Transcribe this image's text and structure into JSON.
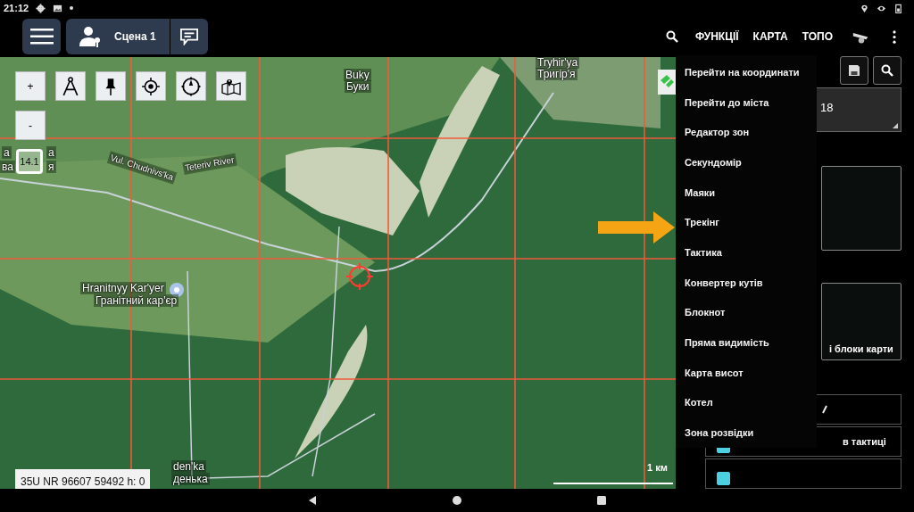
{
  "status_bar": {
    "time": "21:12"
  },
  "app_bar": {
    "scene_label": "Сцена 1",
    "actions": [
      "ФУНКЦІЇ",
      "КАРТА",
      "ТОПО"
    ]
  },
  "map": {
    "zoom": "14.1",
    "scale": "1 км",
    "coordinates": "35U NR 96607 59492 h: 0",
    "zoom_in": "+",
    "zoom_out": "-",
    "labels": [
      {
        "text": "Buky"
      },
      {
        "text": "Буки"
      },
      {
        "text": "Tryhir'ya"
      },
      {
        "text": "Тригір'я"
      },
      {
        "text": "Vul. Chudnivs'ka"
      },
      {
        "text": "Teteriv River"
      },
      {
        "text": "Hranitnyy Kar'yer"
      },
      {
        "text": "Гранітний кар'єр"
      },
      {
        "text": "den'ka"
      },
      {
        "text": "денька"
      },
      {
        "text": "а"
      },
      {
        "text": "ва"
      },
      {
        "text": "а"
      },
      {
        "text": "я"
      }
    ]
  },
  "menu": {
    "items": [
      "Перейти на координати",
      "Перейти до міста",
      "Редактор зон",
      "Секундомір",
      "Маяки",
      "Трекінг",
      "Тактика",
      "Конвертер кутів",
      "Блокнот",
      "Пряма видимість",
      "Карта висот",
      "Котел",
      "Зона розвідки"
    ]
  },
  "panel": {
    "field_value": "18",
    "card_text": "і блоки карти",
    "rows": [
      {
        "kind": "tick"
      },
      {
        "kind": "checkbox",
        "label": "в тактиці",
        "checked": true
      },
      {
        "kind": "checkbox",
        "checked": true
      }
    ]
  }
}
